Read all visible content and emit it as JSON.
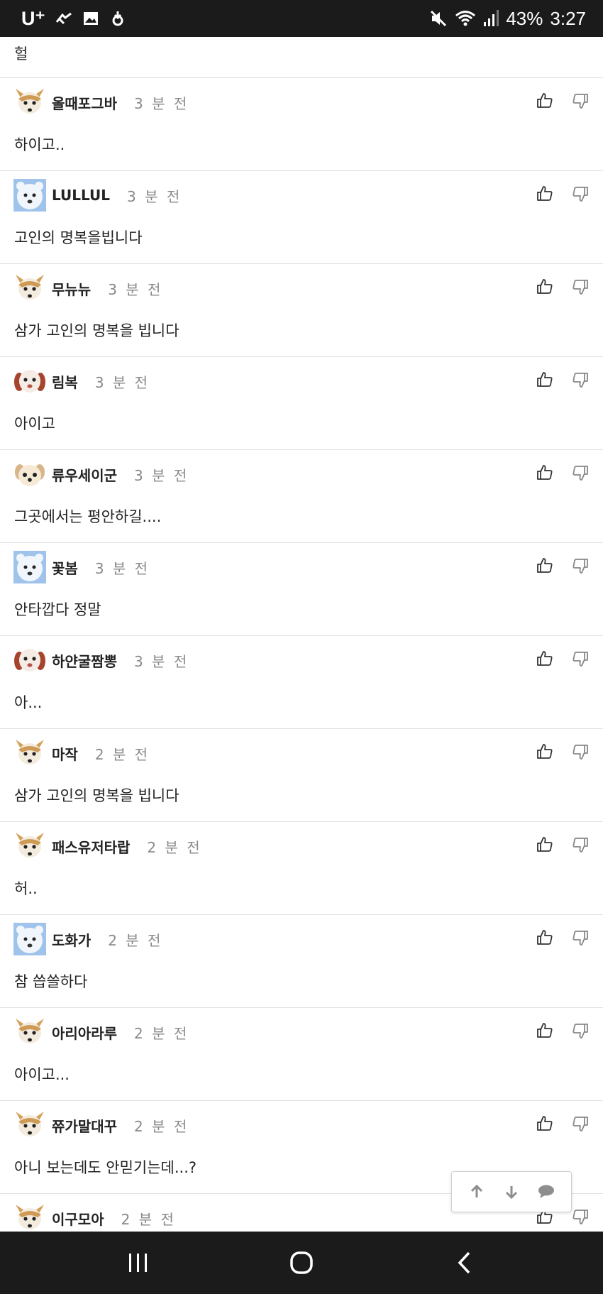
{
  "status_bar": {
    "carrier": "U⁺",
    "battery": "43%",
    "time": "3:27",
    "icons": [
      "carrier-icon",
      "app-icon",
      "gallery-icon",
      "download-icon",
      "mute-icon",
      "wifi-icon",
      "signal-icon"
    ]
  },
  "first_comment_text": "헐",
  "comments": [
    {
      "author": "올때포그바",
      "time": "3 분 전",
      "text": "하이고..",
      "avatar": "fox"
    },
    {
      "author": "LULLUL",
      "time": "3 분 전",
      "text": "고인의 명복을빕니다",
      "avatar": "bear"
    },
    {
      "author": "무뉴뉴",
      "time": "3 분 전",
      "text": "삼가 고인의 명복을 빕니다",
      "avatar": "fox"
    },
    {
      "author": "림복",
      "time": "3 분 전",
      "text": "아이고",
      "avatar": "dog"
    },
    {
      "author": "류우세이군",
      "time": "3 분 전",
      "text": "그곳에서는 평안하길....",
      "avatar": "puppy"
    },
    {
      "author": "꽃봄",
      "time": "3 분 전",
      "text": "안타깝다 정말",
      "avatar": "bear"
    },
    {
      "author": "하얀굴짬뽕",
      "time": "3 분 전",
      "text": "아...",
      "avatar": "dog"
    },
    {
      "author": "마작",
      "time": "2 분 전",
      "text": "삼가 고인의 명복을 빕니다",
      "avatar": "fox"
    },
    {
      "author": "패스유저타랍",
      "time": "2 분 전",
      "text": "허..",
      "avatar": "fox"
    },
    {
      "author": "도화가",
      "time": "2 분 전",
      "text": "참 씁쓸하다",
      "avatar": "bear"
    },
    {
      "author": "아리아라루",
      "time": "2 분 전",
      "text": "아이고...",
      "avatar": "fox"
    },
    {
      "author": "쮸가말대꾸",
      "time": "2 분 전",
      "text": "아니 보는데도 안믿기는데...?",
      "avatar": "fox"
    },
    {
      "author": "이구모아",
      "time": "2 분 전",
      "text": "",
      "avatar": "fox"
    }
  ],
  "vote_icons": [
    "thumbs-up-icon",
    "thumbs-down-icon"
  ],
  "float_nav": [
    "arrow-up-icon",
    "arrow-down-icon",
    "comment-icon"
  ],
  "nav_bar": [
    "recent-apps-icon",
    "home-icon",
    "back-icon"
  ]
}
